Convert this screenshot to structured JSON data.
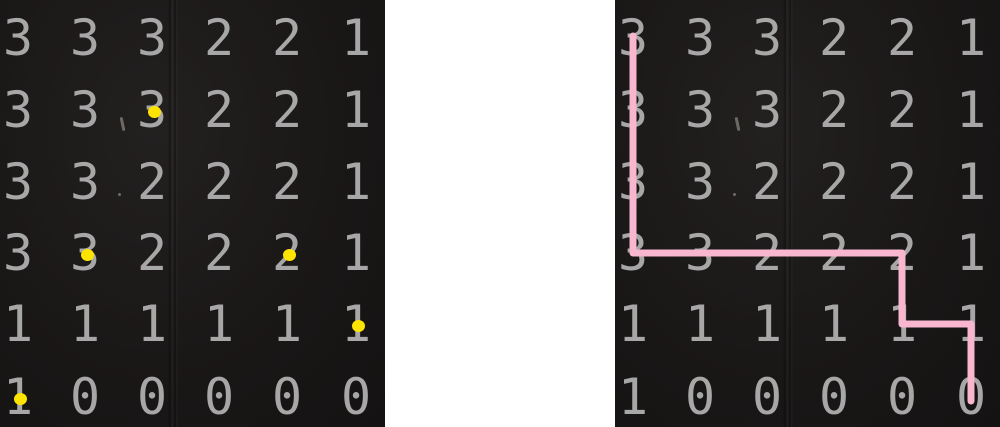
{
  "grid": [
    [
      "3",
      "3",
      "3",
      "2",
      "2",
      "1"
    ],
    [
      "3",
      "3",
      "3",
      "2",
      "2",
      "1"
    ],
    [
      "3",
      "3",
      "2",
      "2",
      "2",
      "1"
    ],
    [
      "3",
      "3",
      "2",
      "2",
      "2",
      "1"
    ],
    [
      "1",
      "1",
      "1",
      "1",
      "1",
      "1"
    ],
    [
      "1",
      "0",
      "0",
      "0",
      "0",
      "0"
    ]
  ],
  "dot_cells": [
    [
      1,
      2
    ],
    [
      3,
      1
    ],
    [
      3,
      4
    ],
    [
      4,
      5
    ],
    [
      5,
      0
    ]
  ],
  "path_cells": [
    [
      0,
      0
    ],
    [
      1,
      0
    ],
    [
      2,
      0
    ],
    [
      3,
      0
    ],
    [
      3,
      1
    ],
    [
      3,
      2
    ],
    [
      3,
      3
    ],
    [
      3,
      4
    ],
    [
      4,
      4
    ],
    [
      4,
      5
    ],
    [
      5,
      5
    ]
  ],
  "colors": {
    "panel_bg": "#1a1717",
    "digit": "#a7a7a7",
    "dot": "#ffe400",
    "path": "#f8b7cf"
  }
}
